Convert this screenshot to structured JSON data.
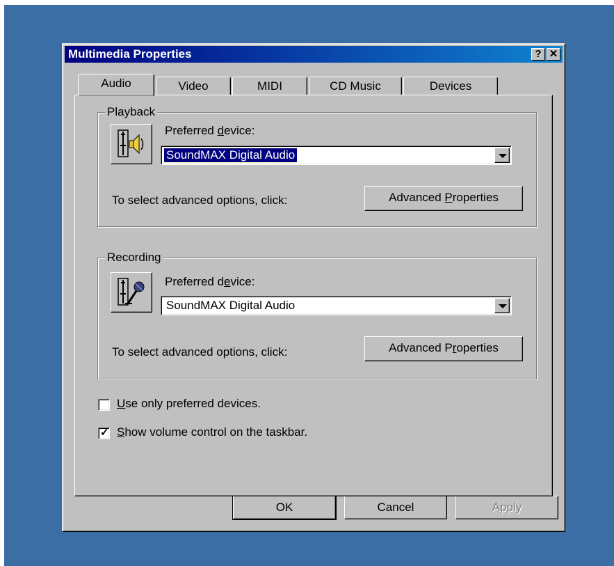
{
  "colors": {
    "desktop": "#3a6ea5",
    "titlebar_start": "#000080",
    "titlebar_end": "#1084d0",
    "face": "#c0c0c0",
    "selection": "#000080"
  },
  "window": {
    "title": "Multimedia Properties",
    "help_button": "?",
    "close_button": "✕"
  },
  "tabs": [
    {
      "label": "Audio",
      "active": true
    },
    {
      "label": "Video",
      "active": false
    },
    {
      "label": "MIDI",
      "active": false
    },
    {
      "label": "CD Music",
      "active": false
    },
    {
      "label": "Devices",
      "active": false
    }
  ],
  "playback": {
    "group_label": "Playback",
    "preferred_label_pre": "Preferred ",
    "preferred_label_mnemonic": "d",
    "preferred_label_post": "evice:",
    "device": "SoundMAX Digital Audio",
    "advanced_text": "To select advanced options, click:",
    "advanced_button_pre": "Advanced ",
    "advanced_button_mnemonic": "P",
    "advanced_button_post": "roperties",
    "icon": "speaker-icon"
  },
  "recording": {
    "group_label": "Recording",
    "preferred_label_pre": "Preferred d",
    "preferred_label_mnemonic": "e",
    "preferred_label_post": "vice:",
    "device": "SoundMAX Digital Audio",
    "advanced_text": "To select advanced options, click:",
    "advanced_button_pre": "Advanced P",
    "advanced_button_mnemonic": "r",
    "advanced_button_post": "operties",
    "icon": "microphone-icon"
  },
  "options": {
    "use_preferred_mnemonic": "U",
    "use_preferred_rest": "se only preferred devices.",
    "use_preferred_checked": false,
    "show_volume_mnemonic": "S",
    "show_volume_rest": "how volume control on the taskbar.",
    "show_volume_checked": true
  },
  "buttons": {
    "ok": "OK",
    "cancel": "Cancel",
    "apply": "Apply"
  }
}
